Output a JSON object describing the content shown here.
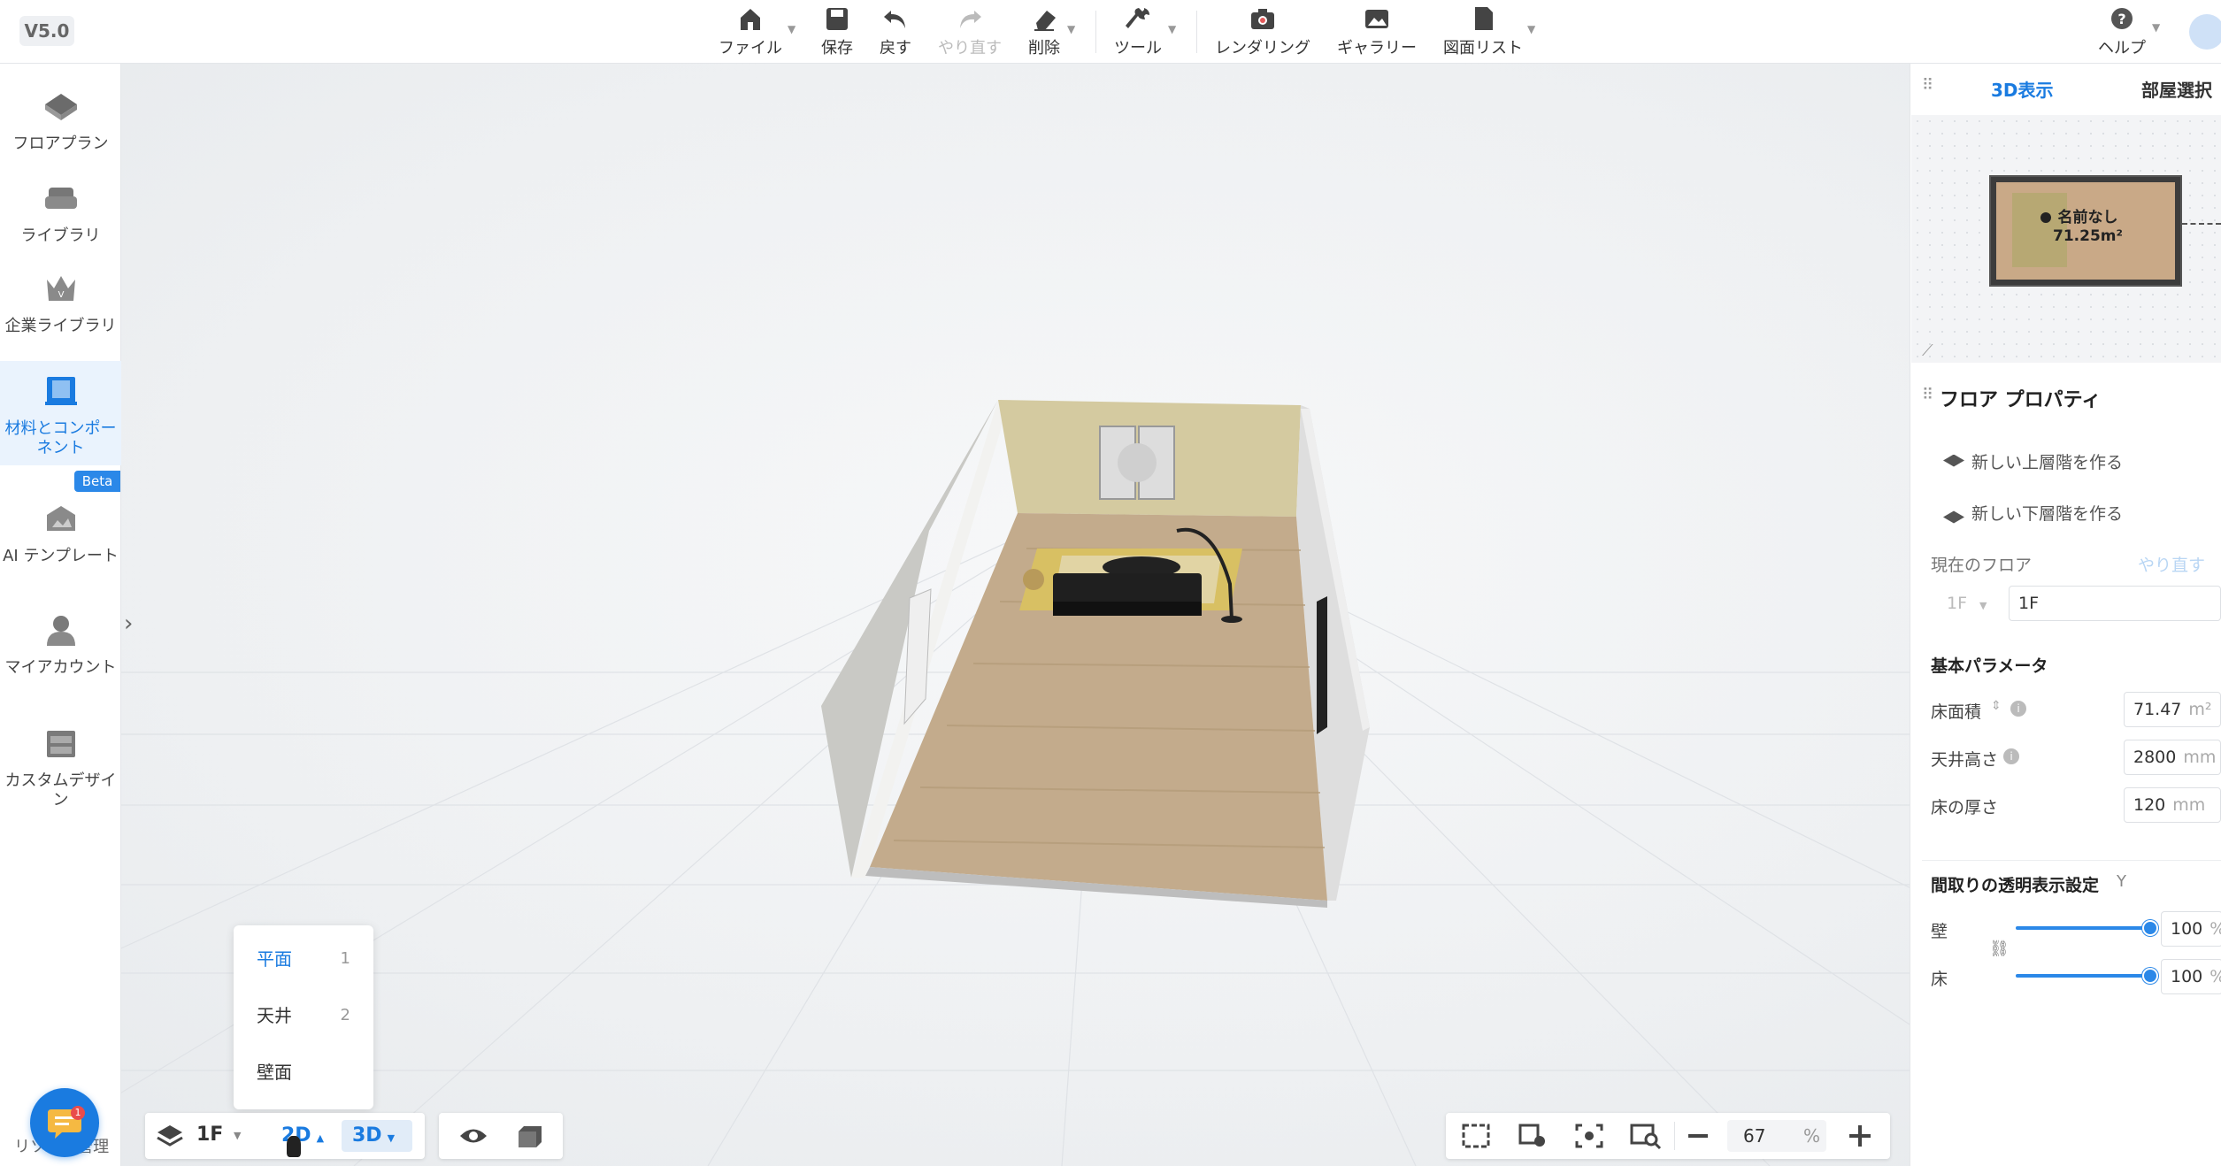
{
  "app": {
    "version": "V5.0"
  },
  "toolbar": {
    "file": "ファイル",
    "save": "保存",
    "undo": "戻す",
    "redo": "やり直す",
    "delete": "削除",
    "tools": "ツール",
    "rendering": "レンダリング",
    "gallery": "ギャラリー",
    "drawing_list": "図面リスト",
    "help": "ヘルプ"
  },
  "sidebar": {
    "items": [
      {
        "label": "フロアプラン",
        "icon": "floorplan-icon"
      },
      {
        "label": "ライブラリ",
        "icon": "sofa-icon"
      },
      {
        "label": "企業ライブラリ",
        "icon": "crown-icon"
      },
      {
        "label": "材料とコンポーネント",
        "icon": "material-icon"
      },
      {
        "label": "AI テンプレート",
        "icon": "ai-template-icon"
      },
      {
        "label": "マイアカウント",
        "icon": "account-icon"
      },
      {
        "label": "カスタムデザイン",
        "icon": "cabinet-icon"
      }
    ],
    "beta": "Beta",
    "bottom_text": "リソース管理"
  },
  "right_panel": {
    "tabs": [
      "3D表示",
      "部屋選択"
    ],
    "minimap": {
      "room_name": "名前なし",
      "area": "71.25m²"
    },
    "floor_props": {
      "title": "フロア プロパティ",
      "new_upper": "新しい上層階を作る",
      "new_lower": "新しい下層階を作る",
      "current_floor_label": "現在のフロア",
      "redo_link": "やり直す",
      "floor_select": "1F",
      "floor_name": "1F"
    },
    "basic_params": {
      "title": "基本パラメータ",
      "floor_area_label": "床面積",
      "floor_area_value": "71.47",
      "floor_area_unit": "m²",
      "ceiling_height_label": "天井高さ",
      "ceiling_height_value": "2800",
      "ceiling_height_unit": "mm",
      "floor_thickness_label": "床の厚さ",
      "floor_thickness_value": "120",
      "floor_thickness_unit": "mm"
    },
    "transparency": {
      "title": "間取りの透明表示設定",
      "wall_label": "壁",
      "wall_value": "100",
      "wall_level": 100,
      "floor_label": "床",
      "floor_value": "100",
      "floor_level": 100,
      "unit": "%"
    }
  },
  "view_menu": {
    "items": [
      {
        "label": "平面",
        "key": "1"
      },
      {
        "label": "天井",
        "key": "2"
      },
      {
        "label": "壁面",
        "key": ""
      }
    ]
  },
  "bottom": {
    "floor": "1F",
    "mode_2d": "2D",
    "mode_3d": "3D",
    "zoom": "67",
    "zoom_unit": "%"
  },
  "colors": {
    "accent": "#1a7be0",
    "slider": "#2b88e8",
    "floor_wood": "#c3ab8c",
    "wall": "#d8cfa8"
  }
}
